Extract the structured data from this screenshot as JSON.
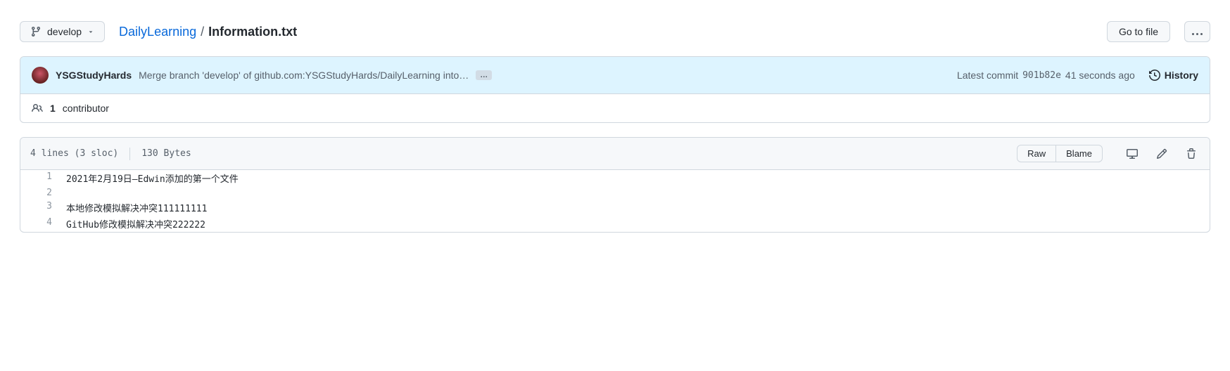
{
  "branch": {
    "name": "develop"
  },
  "breadcrumb": {
    "repo": "DailyLearning",
    "sep": "/",
    "file": "Information.txt"
  },
  "actions": {
    "go_to_file": "Go to file"
  },
  "commit": {
    "author": "YSGStudyHards",
    "message": "Merge branch 'develop' of github.com:YSGStudyHards/DailyLearning into…",
    "ellipsis": "…",
    "latest_label": "Latest commit",
    "sha": "901b82e",
    "time": "41 seconds ago",
    "history_label": "History"
  },
  "contributors": {
    "count": "1",
    "label": "contributor"
  },
  "file_info": {
    "lines": "4 lines (3 sloc)",
    "size": "130 Bytes"
  },
  "file_actions": {
    "raw": "Raw",
    "blame": "Blame"
  },
  "code_lines": [
    {
      "n": "1",
      "t": "2021年2月19日—Edwin添加的第一个文件"
    },
    {
      "n": "2",
      "t": ""
    },
    {
      "n": "3",
      "t": "本地修改模拟解决冲突111111111"
    },
    {
      "n": "4",
      "t": "GitHub修改模拟解决冲突222222"
    }
  ]
}
